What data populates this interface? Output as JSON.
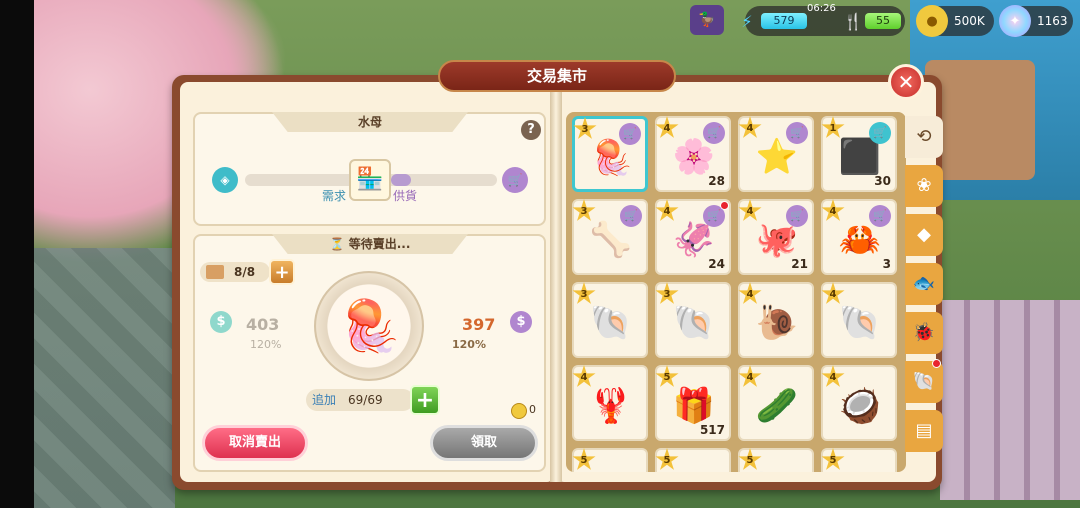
{
  "hud": {
    "energy_value": "579",
    "clock": "06:26",
    "food_value": "55",
    "coins": "500K",
    "gems": "1163"
  },
  "window": {
    "title": "交易集市"
  },
  "item_panel": {
    "item_name": "水母",
    "demand_label": "需求",
    "supply_label": "供貨",
    "demand_level": 0.45,
    "supply_level": 0.08
  },
  "sale_panel": {
    "status": "等待賣出...",
    "slots": "8/8",
    "base_price": "403",
    "base_pct": "120%",
    "sell_price": "397",
    "sell_pct": "120%",
    "add_label": "追加",
    "add_value": "69/69",
    "coin_count": "0",
    "cancel_label": "取消賣出",
    "claim_label": "領取"
  },
  "grid": {
    "items": [
      {
        "icon": "jellyfish",
        "glyph": "🪼",
        "stars": "3",
        "count": "",
        "selected": true,
        "dot": false
      },
      {
        "icon": "sea-anemone",
        "glyph": "🌸",
        "stars": "4",
        "count": "28",
        "selected": false,
        "dot": false
      },
      {
        "icon": "starfish",
        "glyph": "⭐",
        "stars": "4",
        "count": "",
        "selected": false,
        "dot": false
      },
      {
        "icon": "ore",
        "glyph": "⬛",
        "stars": "1",
        "count": "30",
        "selected": false,
        "dot": false
      },
      {
        "icon": "coral-bone",
        "glyph": "🦴",
        "stars": "3",
        "count": "",
        "selected": false,
        "dot": false
      },
      {
        "icon": "squid",
        "glyph": "🦑",
        "stars": "4",
        "count": "24",
        "selected": false,
        "dot": true
      },
      {
        "icon": "octopus",
        "glyph": "🐙",
        "stars": "4",
        "count": "21",
        "selected": false,
        "dot": false
      },
      {
        "icon": "hermit-crab",
        "glyph": "🦀",
        "stars": "4",
        "count": "3",
        "selected": false,
        "dot": false
      },
      {
        "icon": "nautilus",
        "glyph": "🐚",
        "stars": "3",
        "count": "",
        "selected": false,
        "dot": false
      },
      {
        "icon": "scallop",
        "glyph": "🐚",
        "stars": "3",
        "count": "",
        "selected": false,
        "dot": false
      },
      {
        "icon": "conch",
        "glyph": "🐌",
        "stars": "4",
        "count": "",
        "selected": false,
        "dot": false
      },
      {
        "icon": "shell",
        "glyph": "🐚",
        "stars": "4",
        "count": "",
        "selected": false,
        "dot": false
      },
      {
        "icon": "lobster",
        "glyph": "🦞",
        "stars": "4",
        "count": "",
        "selected": false,
        "dot": false
      },
      {
        "icon": "treasure-box",
        "glyph": "🎁",
        "stars": "5",
        "count": "517",
        "selected": false,
        "dot": false
      },
      {
        "icon": "sea-cucumber",
        "glyph": "🥒",
        "stars": "4",
        "count": "",
        "selected": false,
        "dot": false
      },
      {
        "icon": "fossil-shell",
        "glyph": "🥥",
        "stars": "4",
        "count": "",
        "selected": false,
        "dot": false
      },
      {
        "icon": "item-17",
        "glyph": "🦐",
        "stars": "5",
        "count": "",
        "selected": false,
        "dot": false
      },
      {
        "icon": "item-18",
        "glyph": "🦐",
        "stars": "5",
        "count": "",
        "selected": false,
        "dot": false
      },
      {
        "icon": "item-19",
        "glyph": "🐚",
        "stars": "5",
        "count": "",
        "selected": false,
        "dot": false
      },
      {
        "icon": "item-20",
        "glyph": "🦀",
        "stars": "5",
        "count": "",
        "selected": false,
        "dot": false
      }
    ]
  },
  "tabs": [
    {
      "name": "history",
      "glyph": "⟲",
      "active": true,
      "dot": false
    },
    {
      "name": "plants",
      "glyph": "❀",
      "active": false,
      "dot": false
    },
    {
      "name": "materials",
      "glyph": "◆",
      "active": false,
      "dot": false
    },
    {
      "name": "fish",
      "glyph": "🐟",
      "active": false,
      "dot": false
    },
    {
      "name": "insects",
      "glyph": "🐞",
      "active": false,
      "dot": false
    },
    {
      "name": "shells",
      "glyph": "🐚",
      "active": false,
      "dot": true
    },
    {
      "name": "misc",
      "glyph": "▤",
      "active": false,
      "dot": false
    }
  ]
}
